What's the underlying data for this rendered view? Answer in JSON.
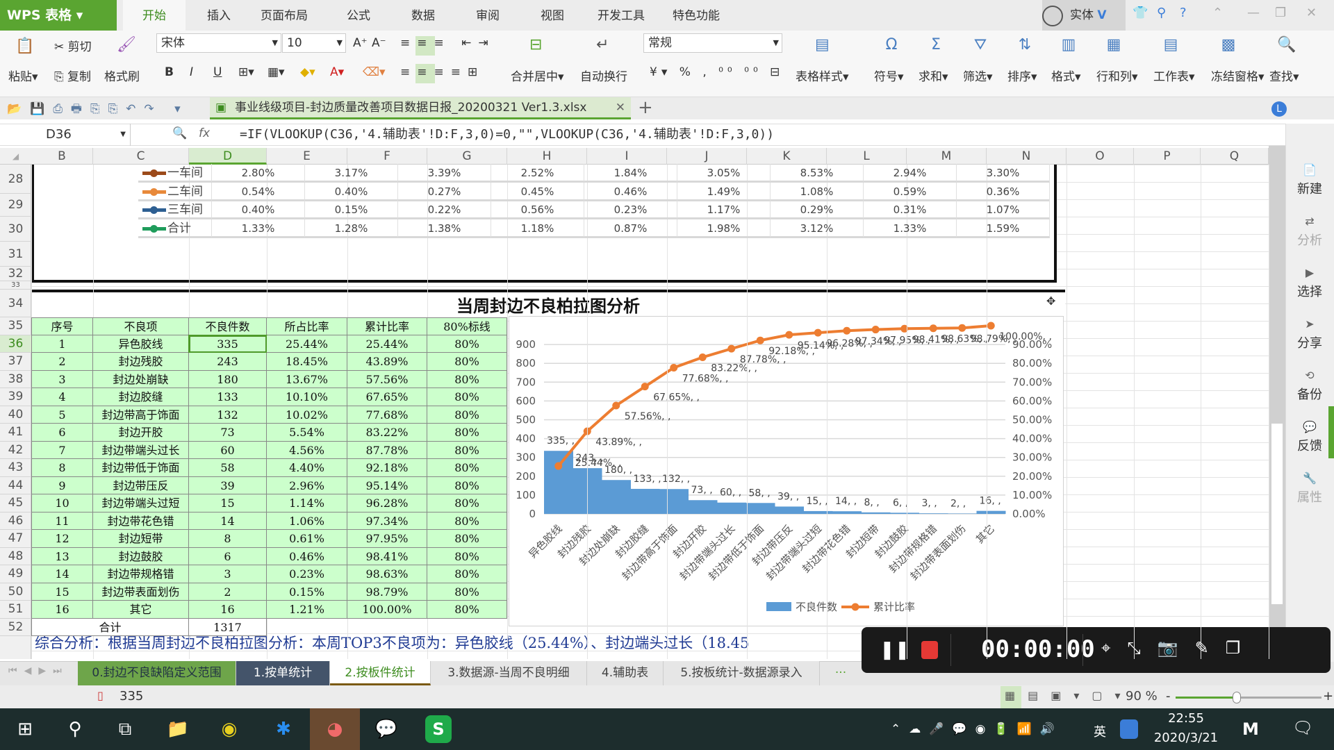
{
  "app": {
    "name": "WPS 表格",
    "account": "实体"
  },
  "menu": [
    "开始",
    "插入",
    "页面布局",
    "公式",
    "数据",
    "审阅",
    "视图",
    "开发工具",
    "特色功能"
  ],
  "ribbon": {
    "paste": "粘贴",
    "cut": "剪切",
    "copy": "复制",
    "format_painter": "格式刷",
    "font": "宋体",
    "font_size": "10",
    "bold": "B",
    "italic": "I",
    "underline": "U",
    "merge": "合并居中",
    "wrap": "自动换行",
    "number_format": "常规",
    "table_style": "表格样式",
    "symbol": "符号",
    "sum": "求和",
    "filter": "筛选",
    "sort": "排序",
    "format": "格式",
    "rowcol": "行和列",
    "worksheet": "工作表",
    "freeze": "冻结窗格",
    "find": "查找"
  },
  "document": {
    "tab": "事业线级项目-封边质量改善项目数据日报_20200321 Ver1.3.xlsx"
  },
  "formula_bar": {
    "cell": "D36",
    "fx": "fx",
    "formula": "=IF(VLOOKUP(C36,'4.辅助表'!D:F,3,0)=0,\"\",VLOOKUP(C36,'4.辅助表'!D:F,3,0))"
  },
  "columns": [
    "B",
    "C",
    "D",
    "E",
    "F",
    "G",
    "H",
    "I",
    "J",
    "K",
    "L",
    "M",
    "N",
    "O",
    "P",
    "Q"
  ],
  "rows": [
    "28",
    "29",
    "30",
    "31",
    "32",
    "33",
    "34",
    "35",
    "36",
    "37",
    "38",
    "39",
    "40",
    "41",
    "42",
    "43",
    "44",
    "45",
    "46",
    "47",
    "48",
    "49",
    "50",
    "51",
    "52"
  ],
  "upper_table": [
    {
      "label": "一车间",
      "color": "#9c4a1a",
      "values": [
        "2.80%",
        "3.17%",
        "3.39%",
        "2.52%",
        "1.84%",
        "3.05%",
        "8.53%",
        "2.94%",
        "3.30%"
      ]
    },
    {
      "label": "二车间",
      "color": "#e8893a",
      "values": [
        "0.54%",
        "0.40%",
        "0.27%",
        "0.45%",
        "0.46%",
        "1.49%",
        "1.08%",
        "0.59%",
        "0.36%"
      ]
    },
    {
      "label": "三车间",
      "color": "#2e5f92",
      "values": [
        "0.40%",
        "0.15%",
        "0.22%",
        "0.56%",
        "0.23%",
        "1.17%",
        "0.29%",
        "0.31%",
        "1.07%"
      ]
    },
    {
      "label": "合计",
      "color": "#1f9c5b",
      "values": [
        "1.33%",
        "1.28%",
        "1.38%",
        "1.18%",
        "0.87%",
        "1.98%",
        "3.12%",
        "1.33%",
        "1.59%"
      ]
    }
  ],
  "pareto": {
    "title": "当周封边不良柏拉图分析",
    "headers": [
      "序号",
      "不良项",
      "不良件数",
      "所占比率",
      "累计比率",
      "80%标线"
    ],
    "rows": [
      [
        "1",
        "异色胶线",
        "335",
        "25.44%",
        "25.44%",
        "80%"
      ],
      [
        "2",
        "封边残胶",
        "243",
        "18.45%",
        "43.89%",
        "80%"
      ],
      [
        "3",
        "封边处崩缺",
        "180",
        "13.67%",
        "57.56%",
        "80%"
      ],
      [
        "4",
        "封边胶缝",
        "133",
        "10.10%",
        "67.65%",
        "80%"
      ],
      [
        "5",
        "封边带高于饰面",
        "132",
        "10.02%",
        "77.68%",
        "80%"
      ],
      [
        "6",
        "封边开胶",
        "73",
        "5.54%",
        "83.22%",
        "80%"
      ],
      [
        "7",
        "封边带端头过长",
        "60",
        "4.56%",
        "87.78%",
        "80%"
      ],
      [
        "8",
        "封边带低于饰面",
        "58",
        "4.40%",
        "92.18%",
        "80%"
      ],
      [
        "9",
        "封边带压反",
        "39",
        "2.96%",
        "95.14%",
        "80%"
      ],
      [
        "10",
        "封边带端头过短",
        "15",
        "1.14%",
        "96.28%",
        "80%"
      ],
      [
        "11",
        "封边带花色错",
        "14",
        "1.06%",
        "97.34%",
        "80%"
      ],
      [
        "12",
        "封边短带",
        "8",
        "0.61%",
        "97.95%",
        "80%"
      ],
      [
        "13",
        "封边鼓胶",
        "6",
        "0.46%",
        "98.41%",
        "80%"
      ],
      [
        "14",
        "封边带规格错",
        "3",
        "0.23%",
        "98.63%",
        "80%"
      ],
      [
        "15",
        "封边带表面划伤",
        "2",
        "0.15%",
        "98.79%",
        "80%"
      ],
      [
        "16",
        "其它",
        "16",
        "1.21%",
        "100.00%",
        "80%"
      ]
    ],
    "total_label": "合计",
    "total_value": "1317"
  },
  "chart_data": {
    "type": "bar+line",
    "categories": [
      "异色胶线",
      "封边残胶",
      "封边处崩缺",
      "封边胶缝",
      "封边带高于饰面",
      "封边开胶",
      "封边带端头过长",
      "封边带低于饰面",
      "封边带压反",
      "封边带端头过短",
      "封边带花色错",
      "封边短带",
      "封边鼓胶",
      "封边带规格错",
      "封边带表面划伤",
      "其它"
    ],
    "series": [
      {
        "name": "不良件数",
        "type": "bar",
        "axis": "left",
        "color": "#5b9bd5",
        "values": [
          335,
          243,
          180,
          133,
          132,
          73,
          60,
          58,
          39,
          15,
          14,
          8,
          6,
          3,
          2,
          16
        ]
      },
      {
        "name": "累计比率",
        "type": "line",
        "axis": "right",
        "color": "#ed7d31",
        "values": [
          25.44,
          43.89,
          57.56,
          67.65,
          77.68,
          83.22,
          87.78,
          92.18,
          95.14,
          96.28,
          97.34,
          97.95,
          98.41,
          98.63,
          98.79,
          100.0
        ]
      }
    ],
    "y_left": {
      "ticks": [
        "0",
        "100",
        "200",
        "300",
        "400",
        "500",
        "600",
        "700",
        "800",
        "900"
      ],
      "range": [
        0,
        1000
      ]
    },
    "y_right": {
      "ticks": [
        "0.00%",
        "10.00%",
        "20.00%",
        "30.00%",
        "40.00%",
        "50.00%",
        "60.00%",
        "70.00%",
        "80.00%",
        "90.00%"
      ],
      "range": [
        0,
        100
      ]
    },
    "grid": true,
    "legend": "bottom"
  },
  "comment": "综合分析：根据当周封边不良柏拉图分析：本周TOP3不良项为：异色胶线（25.44%）、封边端头过长（18.45",
  "sheet_tabs": [
    "0.封边不良缺陷定义范围",
    "1.按单统计",
    "2.按板件统计",
    "3.数据源-当周不良明细",
    "4.辅助表",
    "5.按板统计-数据源录入"
  ],
  "sheet_more": "···",
  "status": {
    "value": "335",
    "zoom": "90 %",
    "zoom_level": 90
  },
  "sidebar": [
    "新建",
    "分析",
    "选择",
    "分享",
    "备份",
    "反馈",
    "属性"
  ],
  "recorder": {
    "time": "00:00:00"
  },
  "taskbar": {
    "time": "22:55",
    "date": "2020/3/21",
    "ime": "英"
  }
}
